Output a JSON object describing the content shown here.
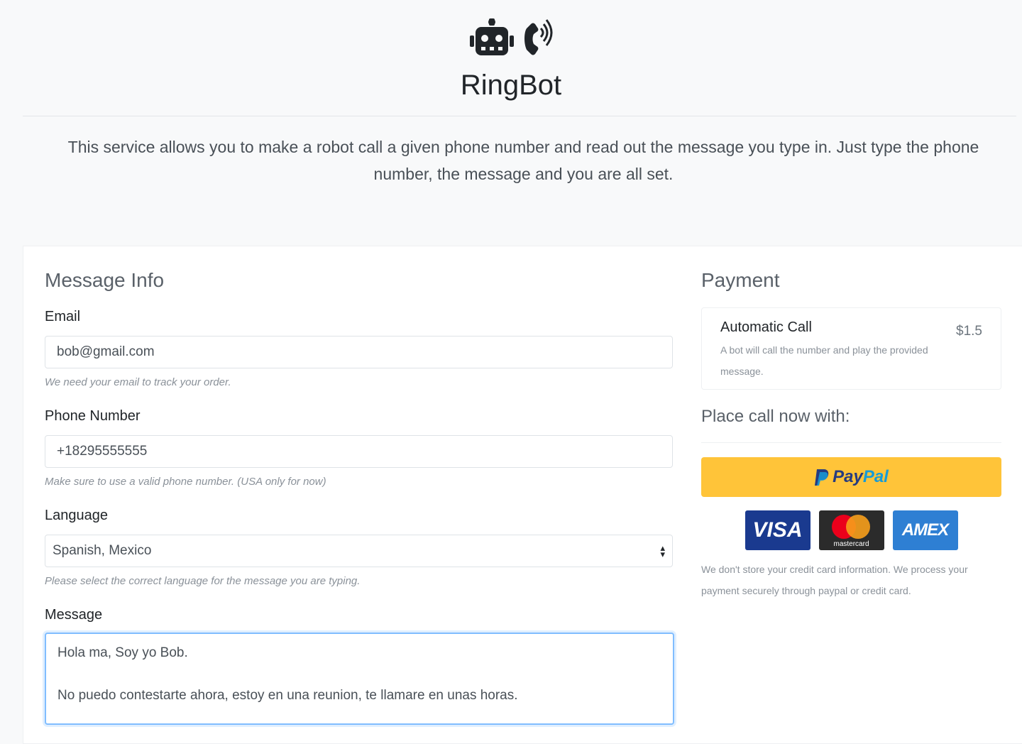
{
  "header": {
    "brand": "RingBot",
    "lead": "This service allows you to make a robot call a given phone number and read out the message you type in. Just type the phone number, the message and you are all set."
  },
  "message_info": {
    "title": "Message Info",
    "email": {
      "label": "Email",
      "value": "bob@gmail.com",
      "help": "We need your email to track your order."
    },
    "phone": {
      "label": "Phone Number",
      "value": "+18295555555",
      "help": "Make sure to use a valid phone number. (USA only for now)"
    },
    "language": {
      "label": "Language",
      "value": "Spanish, Mexico",
      "help": "Please select the correct language for the message you are typing."
    },
    "message": {
      "label": "Message",
      "line1": "Hola ma, Soy yo Bob.",
      "line2": "No puedo contestarte ahora, estoy en una reunion, te llamare en unas horas."
    }
  },
  "payment": {
    "title": "Payment",
    "product": {
      "name": "Automatic Call",
      "description": "A bot will call the number and play the provided message.",
      "price": "$1.5"
    },
    "place_call": "Place call now with:",
    "paypal": {
      "part1": "Pay",
      "part2": "Pal"
    },
    "cards": {
      "visa": "VISA",
      "mastercard": "mastercard",
      "amex": "AMEX"
    },
    "note": "We don't store your credit card information. We process your payment securely through paypal or credit card."
  },
  "colors": {
    "paypal_yellow": "#ffc439",
    "focus_blue": "#80bdff",
    "visa_blue": "#1a3a8f",
    "amex_blue": "#2e7fd3"
  }
}
